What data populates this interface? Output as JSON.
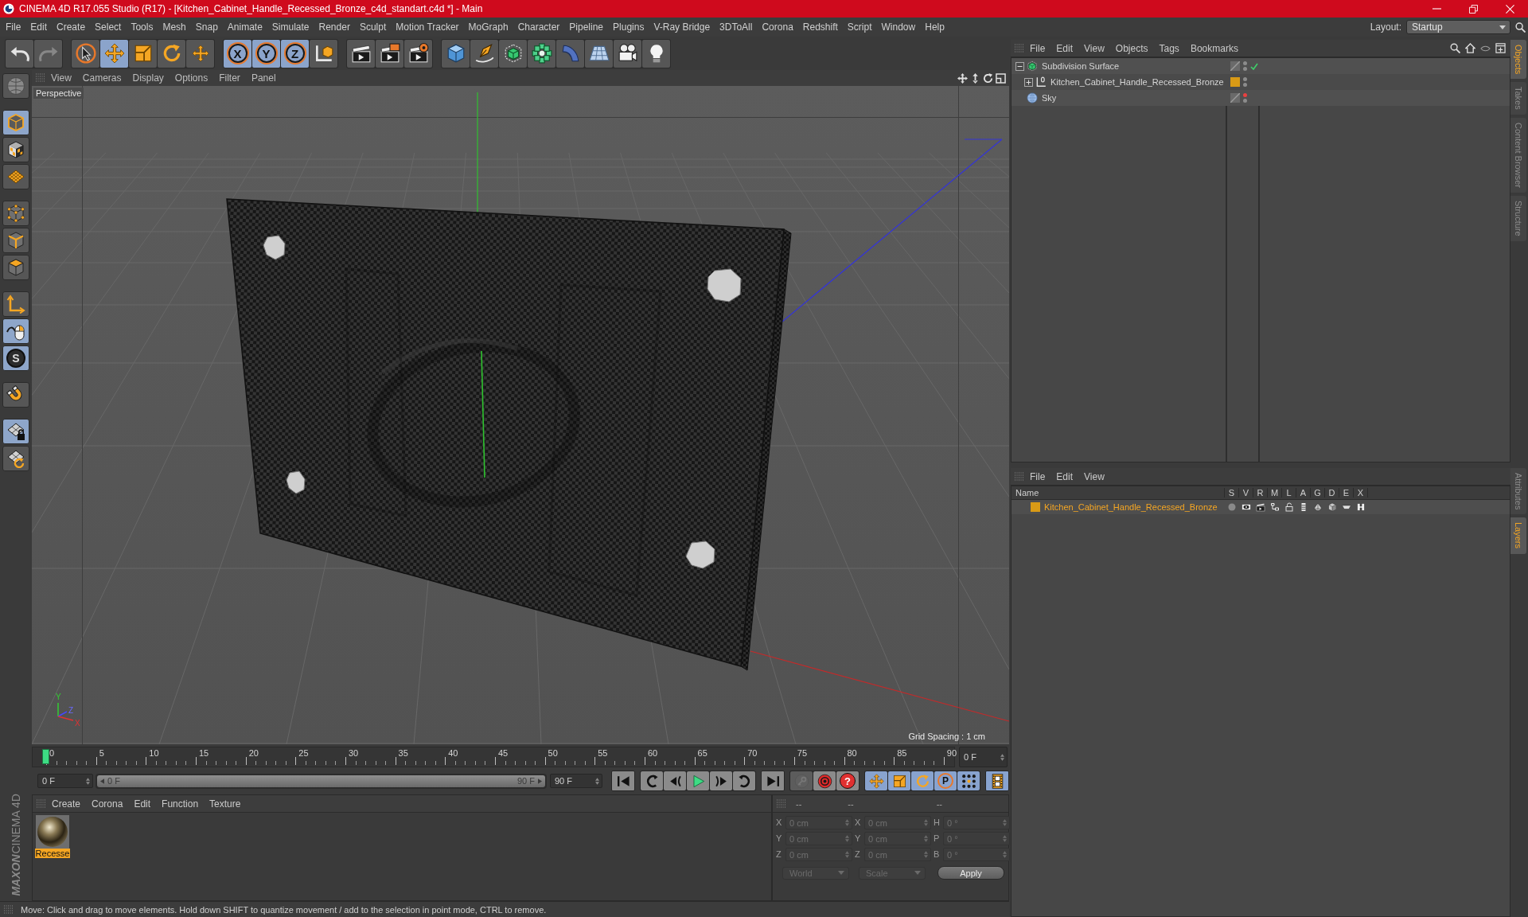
{
  "window": {
    "title": "CINEMA 4D R17.055 Studio (R17) - [Kitchen_Cabinet_Handle_Recessed_Bronze_c4d_standart.c4d *] - Main"
  },
  "menu_bar": {
    "items": [
      "File",
      "Edit",
      "Create",
      "Select",
      "Tools",
      "Mesh",
      "Snap",
      "Animate",
      "Simulate",
      "Render",
      "Sculpt",
      "Motion Tracker",
      "MoGraph",
      "Character",
      "Pipeline",
      "Plugins",
      "V-Ray Bridge",
      "3DToAll",
      "Corona",
      "Redshift",
      "Script",
      "Window",
      "Help"
    ],
    "layout_label": "Layout:",
    "layout_value": "Startup"
  },
  "toolbar": {
    "groups": [
      [
        {
          "kind": "undo",
          "selected": false,
          "disabled": false
        },
        {
          "kind": "redo",
          "selected": false,
          "disabled": true
        }
      ],
      [
        {
          "kind": "live_select",
          "selected": false,
          "disabled": false
        },
        {
          "kind": "move",
          "selected": true,
          "disabled": false
        },
        {
          "kind": "scale",
          "selected": false,
          "disabled": false
        },
        {
          "kind": "rotate",
          "selected": false,
          "disabled": false
        },
        {
          "kind": "transform",
          "selected": false,
          "disabled": false
        }
      ],
      [
        {
          "kind": "axis_lock",
          "label": "X",
          "selected": true,
          "disabled": false
        },
        {
          "kind": "axis_lock",
          "label": "Y",
          "selected": true,
          "disabled": false
        },
        {
          "kind": "axis_lock",
          "label": "Z",
          "selected": true,
          "disabled": false
        },
        {
          "kind": "coordinate_system",
          "selected": false,
          "disabled": false
        }
      ],
      [
        {
          "kind": "render_view",
          "selected": false,
          "disabled": false
        },
        {
          "kind": "render_picture",
          "selected": false,
          "disabled": false
        },
        {
          "kind": "render_settings",
          "selected": false,
          "disabled": false
        }
      ],
      [
        {
          "kind": "cube",
          "selected": false,
          "disabled": false
        },
        {
          "kind": "pen",
          "selected": false,
          "disabled": false
        },
        {
          "kind": "subdivision",
          "selected": false,
          "disabled": false
        },
        {
          "kind": "cloner",
          "selected": false,
          "disabled": false
        },
        {
          "kind": "bend",
          "selected": false,
          "disabled": false
        },
        {
          "kind": "floor",
          "selected": false,
          "disabled": false
        },
        {
          "kind": "camera",
          "selected": false,
          "disabled": false
        },
        {
          "kind": "light",
          "selected": false,
          "disabled": false
        }
      ]
    ]
  },
  "tool_palette": {
    "groups": [
      [
        {
          "kind": "viewport_solo",
          "selected": false
        }
      ],
      [
        {
          "kind": "model",
          "selected": true
        },
        {
          "kind": "texture",
          "selected": false
        },
        {
          "kind": "workplane",
          "selected": false
        }
      ],
      [
        {
          "kind": "points",
          "selected": false
        },
        {
          "kind": "edges",
          "selected": false
        },
        {
          "kind": "polygons",
          "selected": false
        }
      ],
      [
        {
          "kind": "axis",
          "selected": false
        },
        {
          "kind": "tweak",
          "selected": true
        },
        {
          "kind": "snap",
          "label": "S",
          "selected": true
        }
      ],
      [
        {
          "kind": "magnet",
          "selected": false
        }
      ],
      [
        {
          "kind": "grid_lock",
          "selected": true
        },
        {
          "kind": "grid_rotate",
          "selected": false
        }
      ]
    ]
  },
  "viewport": {
    "menu": [
      "View",
      "Cameras",
      "Display",
      "Options",
      "Filter",
      "Panel"
    ],
    "camera_label": "Perspective",
    "grid_spacing": "Grid Spacing : 1 cm",
    "axis_labels": [
      "Y",
      "Z",
      "X"
    ]
  },
  "timeline": {
    "ticks": [
      "0",
      "5",
      "10",
      "15",
      "20",
      "25",
      "30",
      "35",
      "40",
      "45",
      "50",
      "55",
      "60",
      "65",
      "70",
      "75",
      "80",
      "85",
      "90"
    ],
    "level": 0,
    "frame_field": "0 F"
  },
  "transport": {
    "start_field": "0 F",
    "range": {
      "start": "0 F",
      "end": "90 F",
      "level": 1
    },
    "end_field": "90 F",
    "groups": [
      [
        {
          "kind": "go_start",
          "selected": false,
          "disabled": false
        }
      ],
      [
        {
          "kind": "prev_key",
          "selected": false,
          "disabled": false
        },
        {
          "kind": "prev_frame",
          "selected": false,
          "disabled": false
        },
        {
          "kind": "play",
          "selected": false,
          "disabled": false
        },
        {
          "kind": "next_frame",
          "selected": false,
          "disabled": false
        },
        {
          "kind": "next_key",
          "selected": false,
          "disabled": false
        }
      ],
      [
        {
          "kind": "go_end",
          "selected": false,
          "disabled": false
        }
      ],
      [
        {
          "kind": "record_key",
          "selected": false,
          "disabled": true
        },
        {
          "kind": "record",
          "selected": false,
          "disabled": false
        },
        {
          "kind": "autokey",
          "label": "?",
          "selected": false,
          "disabled": false
        }
      ],
      [
        {
          "kind": "pos_track",
          "selected": true,
          "disabled": false
        },
        {
          "kind": "scale_track",
          "selected": true,
          "disabled": false
        },
        {
          "kind": "rot_track",
          "selected": true,
          "disabled": false
        },
        {
          "kind": "param_track",
          "label": "P",
          "selected": true,
          "disabled": false
        },
        {
          "kind": "pla_track",
          "selected": true,
          "disabled": false
        }
      ],
      [
        {
          "kind": "timeline",
          "selected": true,
          "disabled": false
        }
      ]
    ]
  },
  "material_manager": {
    "menu": [
      "Create",
      "Corona",
      "Edit",
      "Function",
      "Texture"
    ],
    "materials": [
      {
        "name": "Recesse",
        "selected": true
      }
    ]
  },
  "coordinates": {
    "headers": [
      "--",
      "--",
      "--"
    ],
    "rows": [
      {
        "cells": [
          {
            "axis": "X",
            "value": "0 cm"
          },
          {
            "axis": "X",
            "value": "0 cm"
          },
          {
            "axis": "H",
            "value": "0 °"
          }
        ]
      },
      {
        "cells": [
          {
            "axis": "Y",
            "value": "0 cm"
          },
          {
            "axis": "Y",
            "value": "0 cm"
          },
          {
            "axis": "P",
            "value": "0 °"
          }
        ]
      },
      {
        "cells": [
          {
            "axis": "Z",
            "value": "0 cm"
          },
          {
            "axis": "Z",
            "value": "0 cm"
          },
          {
            "axis": "B",
            "value": "0 °"
          }
        ]
      }
    ],
    "space": "World",
    "mode": "Scale",
    "apply": "Apply"
  },
  "logo": {
    "brand": "MAXON",
    "product": "CINEMA 4D"
  },
  "status_bar": {
    "text": "Move: Click and drag to move elements. Hold down SHIFT to quantize movement / add to the selection in point mode, CTRL to remove."
  },
  "object_manager": {
    "menu": [
      "File",
      "Edit",
      "View",
      "Objects",
      "Tags",
      "Bookmarks"
    ],
    "objects": [
      {
        "name": "Subdivision Surface",
        "kind": "subdivision",
        "expanded": true,
        "visible_in_editor": true,
        "visible_in_render": true,
        "enabled": true,
        "children": [
          {
            "name": "Kitchen_Cabinet_Handle_Recessed_Bronze",
            "kind": "null",
            "expanded": false,
            "color": "#d89a16",
            "visible_in_editor": true,
            "visible_in_render": true
          }
        ]
      },
      {
        "name": "Sky",
        "kind": "sky",
        "visible_in_editor": false,
        "visible_in_render": true
      }
    ]
  },
  "layer_manager": {
    "menu": [
      "File",
      "Edit",
      "View"
    ],
    "columns": [
      "Name",
      "S",
      "V",
      "R",
      "M",
      "L",
      "A",
      "G",
      "D",
      "E",
      "X"
    ],
    "layers": [
      {
        "name": "Kitchen_Cabinet_Handle_Recessed_Bronze",
        "color": "#d89a16",
        "selected": true
      }
    ]
  },
  "side_tabs": {
    "upper": [
      {
        "label": "Objects",
        "selected": true
      },
      {
        "label": "Takes",
        "selected": false
      },
      {
        "label": "Content Browser",
        "selected": false
      },
      {
        "label": "Structure",
        "selected": false
      }
    ],
    "lower": [
      {
        "label": "Attributes",
        "selected": false
      },
      {
        "label": "Layers",
        "selected": true
      }
    ]
  }
}
